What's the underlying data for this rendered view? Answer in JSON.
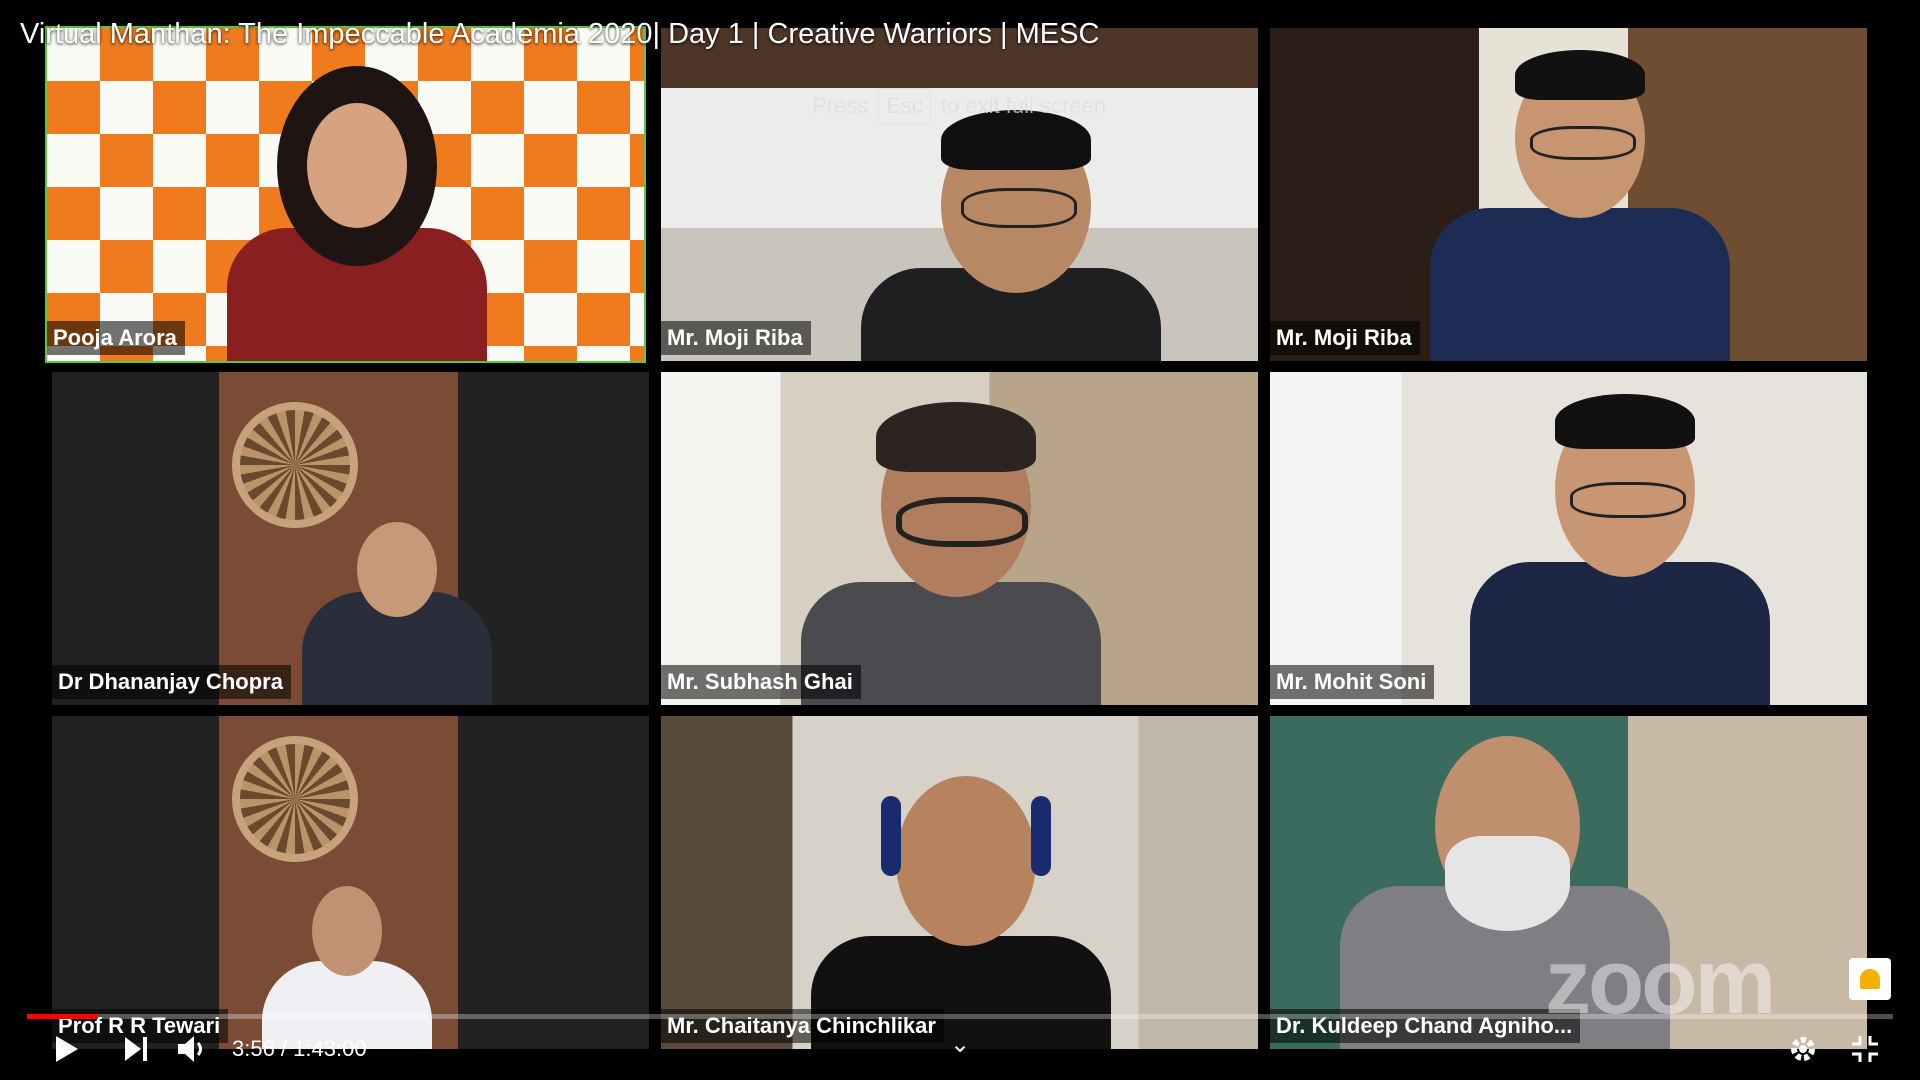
{
  "video": {
    "title": "Virtual Manthan: The Impeccable Academia 2020| Day 1 | Creative Warriors | MESC",
    "fullscreen_hint_pre": "Press",
    "fullscreen_hint_key": "Esc",
    "fullscreen_hint_post": "to exit full screen"
  },
  "participants": [
    {
      "name": "Pooja Arora",
      "active": true
    },
    {
      "name": "Mr. Moji Riba"
    },
    {
      "name": "Mr. Moji Riba"
    },
    {
      "name": "Dr Dhananjay Chopra"
    },
    {
      "name": "Mr. Subhash Ghai"
    },
    {
      "name": "Mr. Mohit Soni"
    },
    {
      "name": "Prof R R Tewari"
    },
    {
      "name": "Mr. Chaitanya Chinchlikar"
    },
    {
      "name": "Dr. Kuldeep Chand Agniho..."
    }
  ],
  "watermark": "zoom",
  "player": {
    "current_time": "3:56",
    "duration": "1:43:00",
    "time_display": "3:56 / 1:43:00",
    "progress_fraction": 0.038,
    "controls": [
      "play-icon",
      "next-icon",
      "volume-icon",
      "chevron-down-icon",
      "settings-icon",
      "exit-fullscreen-icon"
    ]
  },
  "colors": {
    "active_speaker": "#5ac83c",
    "progress_played": "#ff0000",
    "background": "#000000"
  }
}
